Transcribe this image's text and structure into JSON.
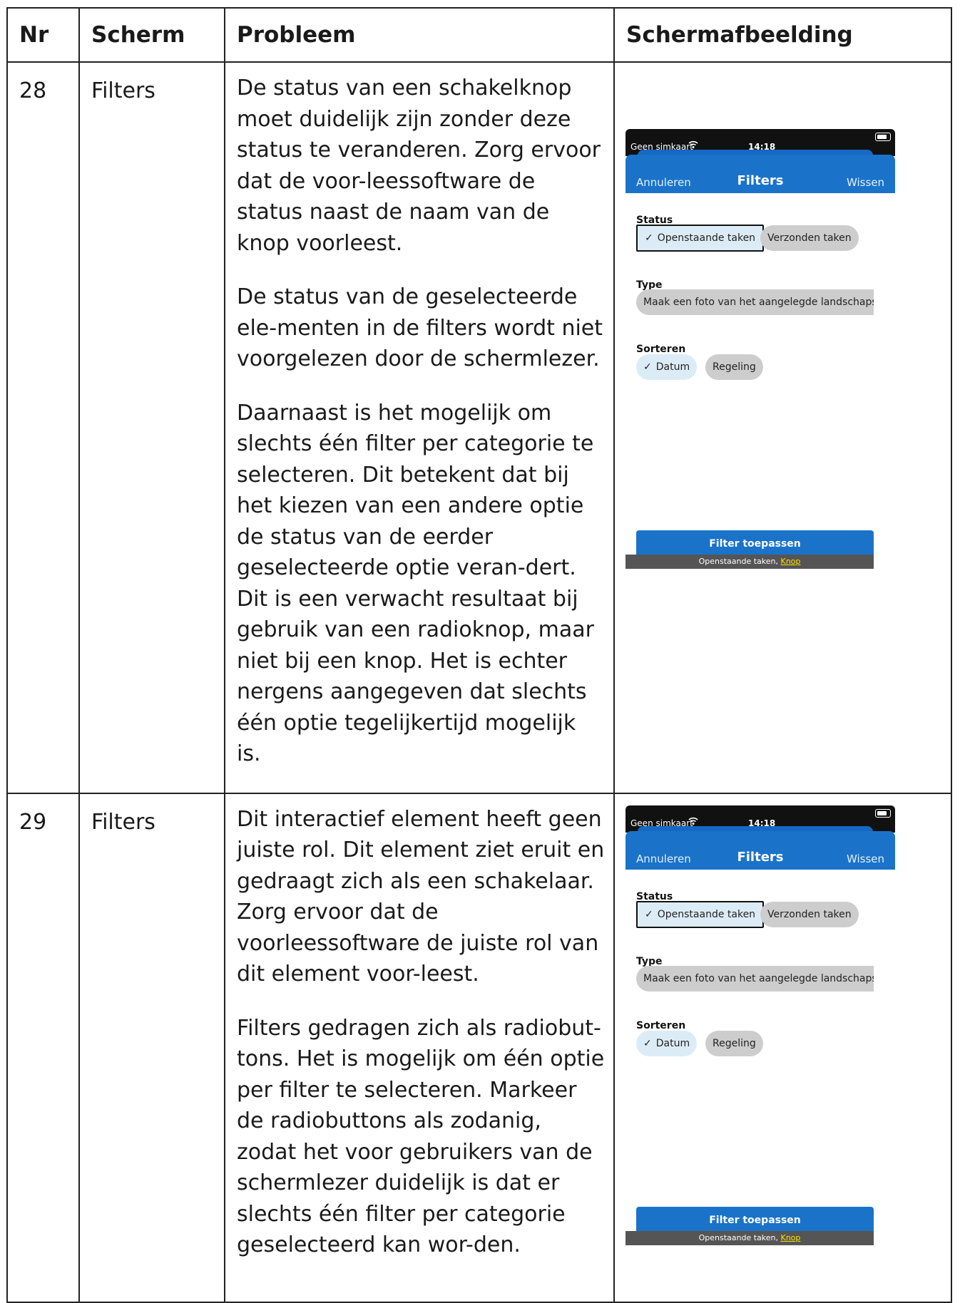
{
  "table": {
    "headers": [
      "Nr",
      "Scherm",
      "Probleem",
      "Schermafbeelding"
    ],
    "rows": [
      {
        "nr": "28",
        "scherm": "Filters",
        "paragraphs": [
          "De status van een schakelknop moet duidelijk zijn zonder deze status te veranderen. Zorg ervoor dat de voor-leessoftware de status naast de naam van de knop voorleest.",
          "De status van de geselecteerde ele-menten in de filters wordt niet voorgelezen door de schermlezer.",
          "Daarnaast is het mogelijk om slechts één filter per categorie te selecteren. Dit betekent dat bij het kiezen van een andere optie de status van de eerder geselecteerde optie veran-dert. Dit is een verwacht resultaat bij gebruik van een radioknop, maar niet bij een knop. Het is echter nergens aangegeven dat slechts één optie tegelijkertijd mogelijk is."
        ]
      },
      {
        "nr": "29",
        "scherm": "Filters",
        "paragraphs": [
          "Dit interactief element heeft geen juiste rol. Dit element ziet eruit en gedraagt zich als een schakelaar. Zorg ervoor dat de voorleessoftware de juiste rol van dit element voor-leest.",
          "Filters gedragen zich als radiobut-tons. Het is mogelijk om één optie per filter te selecteren. Markeer de radiobuttons als zodanig, zodat het voor gebruikers van de schermlezer duidelijk is dat er slechts één filter per categorie geselecteerd kan wor-den."
        ]
      }
    ]
  },
  "phone": {
    "carrier": "Geen simkaart",
    "wifi_icon": "wifi-icon",
    "time": "14:18",
    "cancel": "Annuleren",
    "title": "Filters",
    "clear": "Wissen",
    "status_label": "Status",
    "status_open": "Openstaande taken",
    "status_sent": "Verzonden taken",
    "type_label": "Type",
    "type_value": "Maak een foto van het aangelegde landschapselement",
    "sort_label": "Sorteren",
    "sort_date": "Datum",
    "sort_scheme": "Regeling",
    "apply": "Filter toepassen",
    "vo_text": "Openstaande taken, ",
    "vo_role": "Knop",
    "check_glyph": "✓"
  },
  "colors": {
    "nav_blue": "#1a73c9",
    "chip_selected": "#dcecf7",
    "chip_unselected": "#cdcdcd",
    "vo_role": "#ffe000"
  }
}
